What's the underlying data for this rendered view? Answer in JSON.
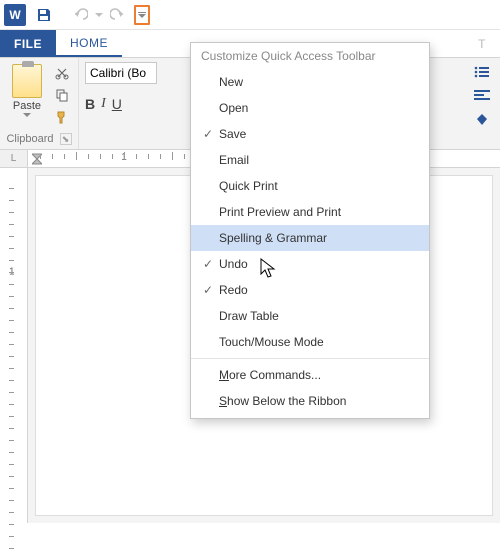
{
  "qat": {
    "app_letter": "W"
  },
  "tabs": {
    "file": "FILE",
    "home": "HOME",
    "hidden_right": "T"
  },
  "ribbon": {
    "clipboard": {
      "paste": "Paste",
      "group": "Clipboard"
    },
    "font": {
      "name_value": "Calibri (Bo",
      "bold": "B",
      "italic": "I",
      "underline": "U"
    }
  },
  "ruler": {
    "gutter": "L",
    "num1": "1"
  },
  "vruler": {
    "num1": "1"
  },
  "menu": {
    "title": "Customize Quick Access Toolbar",
    "items": [
      {
        "label": "New",
        "checked": false
      },
      {
        "label": "Open",
        "checked": false
      },
      {
        "label": "Save",
        "checked": true
      },
      {
        "label": "Email",
        "checked": false
      },
      {
        "label": "Quick Print",
        "checked": false
      },
      {
        "label": "Print Preview and Print",
        "checked": false
      },
      {
        "label": "Spelling & Grammar",
        "checked": false,
        "hover": true
      },
      {
        "label": "Undo",
        "checked": true
      },
      {
        "label": "Redo",
        "checked": true
      },
      {
        "label": "Draw Table",
        "checked": false
      },
      {
        "label": "Touch/Mouse Mode",
        "checked": false
      }
    ],
    "more_pre": "M",
    "more_post": "ore Commands...",
    "show_pre": "S",
    "show_post": "how Below the Ribbon"
  }
}
